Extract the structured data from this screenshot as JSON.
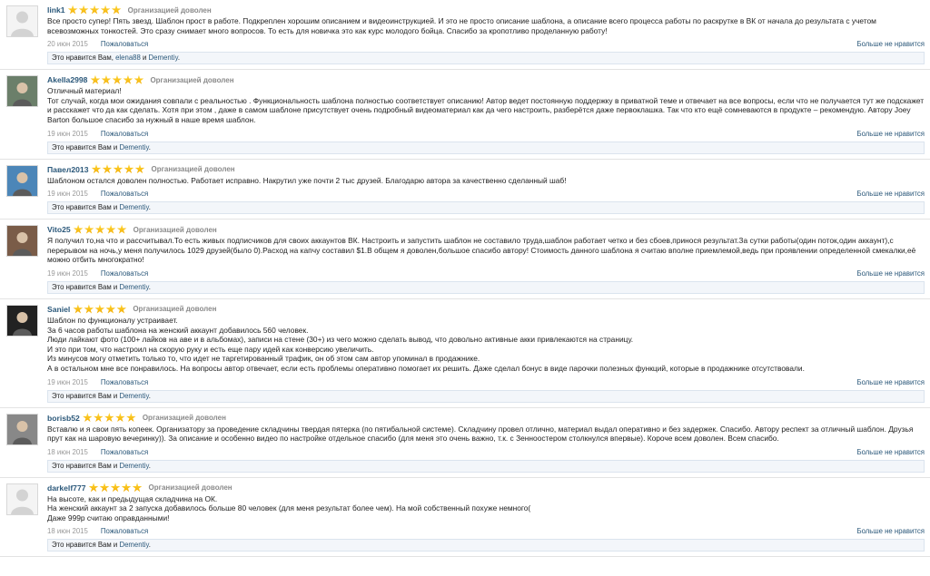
{
  "status_text": "Организацией доволен",
  "report_label": "Пожаловаться",
  "unlike_label": "Больше не нравится",
  "colors": {
    "link": "#2b587a",
    "star": "#f5b800",
    "likes_bg": "#f3f6fa"
  },
  "reviews": [
    {
      "author": "link1",
      "rating": 5,
      "avatar": "default-avatar",
      "lines": [
        "Все просто супер! Пять звезд. Шаблон прост в работе. Подкреплен хорошим описанием и видеоинструкцией. И это не просто описание шаблона, а описание всего процесса работы по раскрутке в ВК от начала до результата с учетом всевозможных тонкостей. Это сразу снимает много вопросов. То есть для новичка это как курс молодого бойца. Спасибо за кропотливо проделанную работу!"
      ],
      "date": "20 июн 2015",
      "likes": {
        "prefix": "Это нравится Вам, ",
        "names": [
          "elena88"
        ],
        "sep": " и ",
        "last": "Dementiy",
        "suffix": "."
      }
    },
    {
      "author": "Akella2998",
      "rating": 5,
      "avatar": "photo-avatar",
      "lines": [
        "Отличный материал!",
        "Тот случай, когда мои ожидания совпали с реальностью . Функциональность шаблона полностью соответствует описанию! Автор ведет постоянную поддержку в приватной теме и отвечает на все вопросы, если что не получается тут же подскажет и расскажет что да как сделать. Хотя при этом , даже в самом шаблоне присутствует очень подробный видеоматериал как да чего настроить, разберётся даже первоклашка. Так что кто ещё сомневаются в продукте – рекомендую. Автору Joey Barton большое спасибо за нужный в наше время шаблон."
      ],
      "date": "19 июн 2015",
      "likes": {
        "prefix": "Это нравится Вам",
        "names": [],
        "sep": " и ",
        "last": "Dementiy",
        "suffix": "."
      }
    },
    {
      "author": "Павел2013",
      "rating": 5,
      "avatar": "photo-avatar",
      "lines": [
        "Шаблоном остался доволен полностью. Работает исправно. Накрутил уже почти 2 тыс друзей. Благодарю автора за качественно сделанный шаб!"
      ],
      "date": "19 июн 2015",
      "likes": {
        "prefix": "Это нравится Вам",
        "names": [],
        "sep": " и ",
        "last": "Dementiy",
        "suffix": "."
      }
    },
    {
      "author": "Vito25",
      "rating": 5,
      "avatar": "photo-avatar",
      "lines": [
        "Я получил то,на что и рассчитывал.То есть живых подписчиков для своих аккаунтов ВК. Настроить и запустить шаблон не составило труда,шаблон работает четко и без сбоев,принося результат.За сутки работы(один поток,один аккаунт),с перерывом на ночь,у меня получилось 1029 друзей(было 0).Расход на капчу составил $1.В общем я доволен,большое спасибо автору! Стоимость данного шаблона я считаю вполне приемлемой,ведь при проявлении определенной смекалки,её можно отбить многократно!"
      ],
      "date": "19 июн 2015",
      "likes": {
        "prefix": "Это нравится Вам",
        "names": [],
        "sep": " и ",
        "last": "Dementiy",
        "suffix": "."
      }
    },
    {
      "author": "Saniel",
      "rating": 5,
      "avatar": "photo-avatar",
      "lines": [
        "Шаблон по функционалу устраивает.",
        "За 6 часов работы шаблона на женский аккаунт добавилось 560 человек.",
        "Люди лайкают фото (100+ лайков на аве и в альбомах), записи на стене (30+) из чего можно сделать вывод, что довольно активные акки привлекаются на страницу.",
        "И это при том, что настроил на скорую руку и есть еще пару идей как конверсию увеличить.",
        "Из минусов могу отметить только то, что идет не таргетированный трафик, он об этом сам автор упоминал в продажнике.",
        "А в остальном мне все понравилось. На вопросы автор отвечает, если есть проблемы оперативно помогает их решить. Даже сделал бонус в виде парочки полезных функций, которые в продажнике отсутствовали."
      ],
      "date": "19 июн 2015",
      "likes": {
        "prefix": "Это нравится Вам",
        "names": [],
        "sep": " и ",
        "last": "Dementiy",
        "suffix": "."
      }
    },
    {
      "author": "borisb52",
      "rating": 5,
      "avatar": "photo-avatar",
      "lines": [
        "Вставлю и я свои пять копеек. Организатору за проведение складчины твердая пятерка (по пятибальной системе). Складчину провел отлично, материал выдал оперативно и без задержек. Спасибо. Автору респект за отличный шаблон. Друзья прут как на шаровую вечеринку)). За описание и особенно видео по настройке отдельное спасибо (для меня это очень важно, т.к. с Зенноостером столкнулся впервые). Короче всем доволен. Всем спасибо."
      ],
      "date": "18 июн 2015",
      "likes": {
        "prefix": "Это нравится Вам",
        "names": [],
        "sep": " и ",
        "last": "Dementiy",
        "suffix": "."
      }
    },
    {
      "author": "darkelf777",
      "rating": 5,
      "avatar": "default-avatar",
      "lines": [
        "На высоте, как и предыдущая складчина на ОК.",
        "На женский аккаунт за 2 запуска добавилось больше 80 человек (для меня результат более чем). На мой собственный похуже немного(",
        "Даже 999р считаю оправданными!"
      ],
      "date": "18 июн 2015",
      "likes": {
        "prefix": "Это нравится Вам",
        "names": [],
        "sep": " и ",
        "last": "Dementiy",
        "suffix": "."
      }
    }
  ]
}
